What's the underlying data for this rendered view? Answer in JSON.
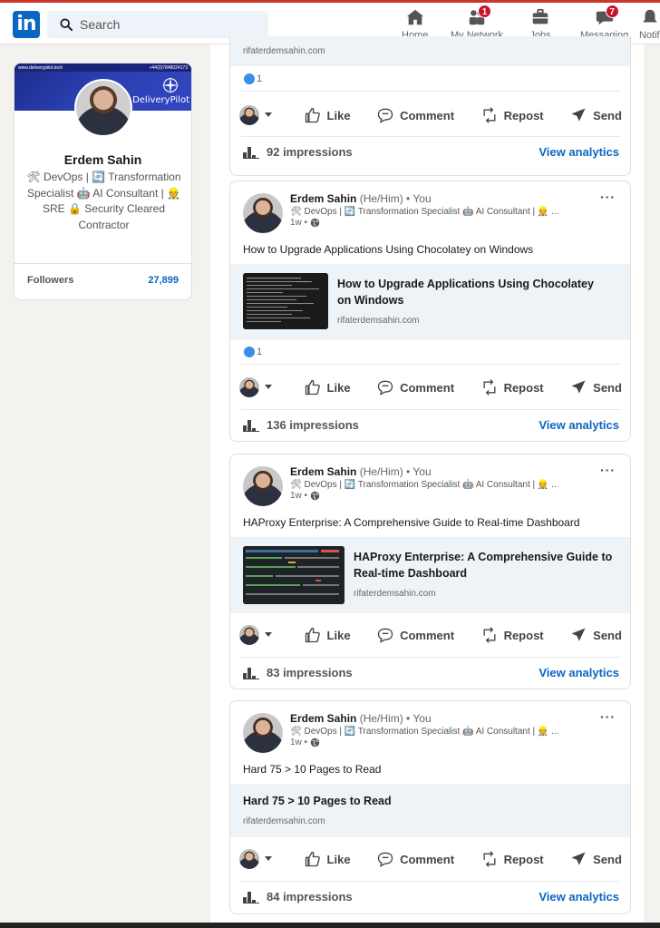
{
  "nav": {
    "logo_text": "in",
    "search_placeholder": "Search",
    "items": [
      {
        "label": "Home",
        "icon": "home-icon"
      },
      {
        "label": "My Network",
        "icon": "network-icon",
        "badge": "1"
      },
      {
        "label": "Jobs",
        "icon": "briefcase-icon"
      },
      {
        "label": "Messaging",
        "icon": "messaging-icon",
        "badge": "7"
      },
      {
        "label": "Notif",
        "icon": "bell-icon"
      }
    ]
  },
  "profile": {
    "banner_top_left": "www.deliverypilot.tech",
    "banner_top_right": "+44(0)7848024173",
    "banner_brand": "DeliveryPilot",
    "name": "Erdem Sahin",
    "headline": "🛠 DevOps | 🔄 Transformation Specialist 🤖 AI Consultant | 👷 SRE 🔒 Security Cleared Contractor",
    "followers_label": "Followers",
    "followers_count": "27,899"
  },
  "actions": {
    "like": "Like",
    "comment": "Comment",
    "repost": "Repost",
    "send": "Send",
    "analytics": "View analytics"
  },
  "posts": [
    {
      "link_domain": "rifaterdemsahin.com",
      "reactions": "1",
      "impressions": "92 impressions"
    },
    {
      "author": "Erdem Sahin",
      "pronouns": "(He/Him)",
      "relation": "• You",
      "headline": "🛠 DevOps | 🔄 Transformation Specialist 🤖 AI Consultant | 👷 ...",
      "time": "1w •",
      "text": "How to Upgrade Applications Using Chocolatey on Windows",
      "link_title": "How to Upgrade Applications Using Chocolatey on Windows",
      "link_domain": "rifaterdemsahin.com",
      "reactions": "1",
      "impressions": "136 impressions"
    },
    {
      "author": "Erdem Sahin",
      "pronouns": "(He/Him)",
      "relation": "• You",
      "headline": "🛠 DevOps | 🔄 Transformation Specialist 🤖 AI Consultant | 👷 ...",
      "time": "1w •",
      "text": "HAProxy Enterprise: A Comprehensive Guide to Real-time Dashboard",
      "link_title": "HAProxy Enterprise: A Comprehensive Guide to Real-time Dashboard",
      "link_domain": "rifaterdemsahin.com",
      "impressions": "83 impressions"
    },
    {
      "author": "Erdem Sahin",
      "pronouns": "(He/Him)",
      "relation": "• You",
      "headline": "🛠 DevOps | 🔄 Transformation Specialist 🤖 AI Consultant | 👷 ...",
      "time": "1w •",
      "text": "Hard 75 > 10 Pages to Read",
      "link_title": "Hard 75 > 10 Pages to Read",
      "link_domain": "rifaterdemsahin.com",
      "impressions": "84 impressions"
    }
  ],
  "colors": {
    "brand": "#0a66c2",
    "badge": "#cb112d",
    "background": "#f4f2ee"
  }
}
